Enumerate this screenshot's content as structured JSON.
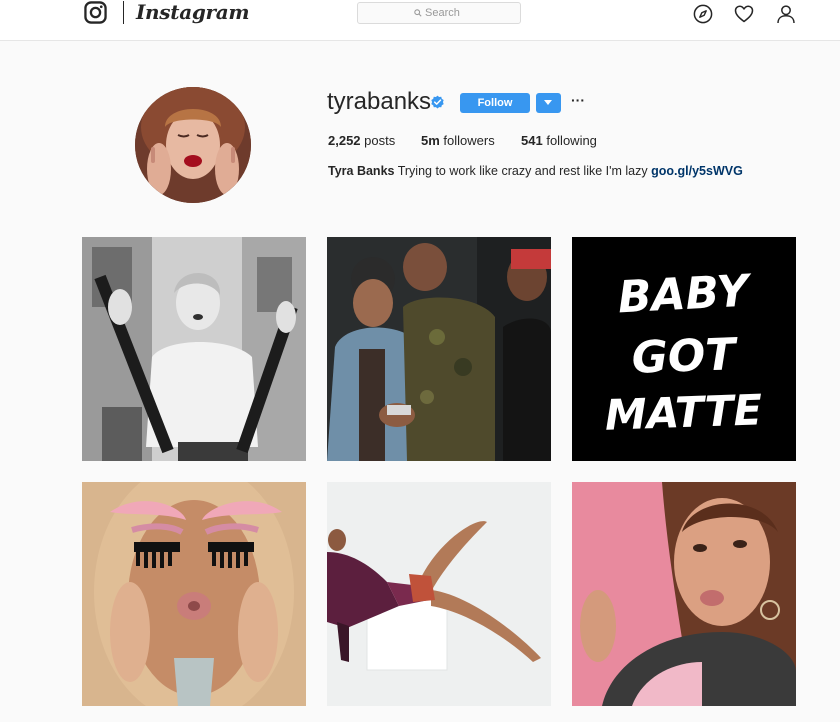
{
  "nav": {
    "brand": "Instagram",
    "search_placeholder": "Search",
    "icons": [
      "instagram-logo-icon",
      "search-icon",
      "compass-icon",
      "heart-icon",
      "profile-icon"
    ]
  },
  "profile": {
    "username": "tyrabanks",
    "verified": true,
    "follow_label": "Follow",
    "more_label": "···",
    "stats": {
      "posts_value": "2,252",
      "posts_label": "posts",
      "followers_value": "5m",
      "followers_label": "followers",
      "following_value": "541",
      "following_label": "following"
    },
    "bio": {
      "full_name": "Tyra Banks",
      "text": "Trying to work like crazy and rest like I'm lazy",
      "link": "goo.gl/y5sWVG"
    }
  },
  "posts": [
    {
      "caption_art": ""
    },
    {
      "caption_art": ""
    },
    {
      "caption_art": "BABY GOT MATTE"
    },
    {
      "caption_art": ""
    },
    {
      "caption_art": ""
    },
    {
      "caption_art": ""
    }
  ],
  "colors": {
    "accent": "#3897f0",
    "link": "#003569",
    "background": "#fafafa",
    "text": "#262626"
  }
}
